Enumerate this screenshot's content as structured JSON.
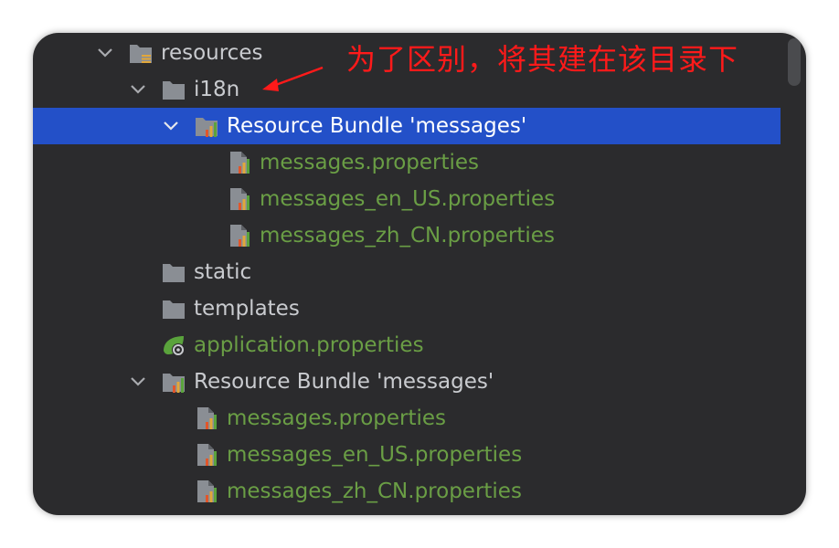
{
  "tree": {
    "resources": {
      "label": "resources"
    },
    "i18n": {
      "label": "i18n"
    },
    "bundle_nested": {
      "label": "Resource Bundle 'messages'",
      "files": [
        {
          "label": "messages.properties"
        },
        {
          "label": "messages_en_US.properties"
        },
        {
          "label": "messages_zh_CN.properties"
        }
      ]
    },
    "static": {
      "label": "static"
    },
    "templates": {
      "label": "templates"
    },
    "application": {
      "label": "application.properties"
    },
    "bundle_root": {
      "label": "Resource Bundle 'messages'",
      "files": [
        {
          "label": "messages.properties"
        },
        {
          "label": "messages_en_US.properties"
        },
        {
          "label": "messages_zh_CN.properties"
        }
      ]
    }
  },
  "annotation": {
    "text": "为了区别，将其建在该目录下"
  },
  "colors": {
    "background": "#2b2b2d",
    "selection": "#2350c8",
    "text": "#c9cbcf",
    "properties_text": "#6a9e45",
    "annotation": "#ff1a1a"
  }
}
